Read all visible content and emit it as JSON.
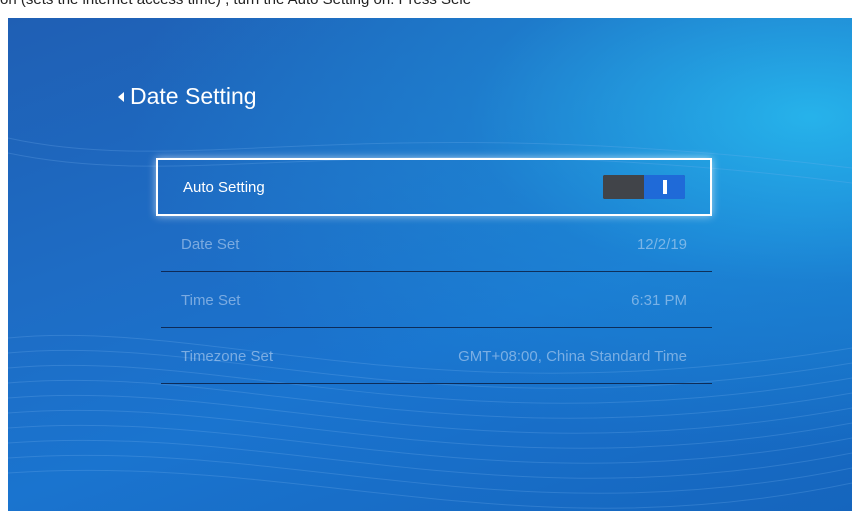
{
  "caption": "on (sets the internet access time) , turn the Auto Setting on. Press Sele",
  "header": {
    "title": "Date Setting",
    "back_icon": "chevron-left-icon"
  },
  "settings": {
    "auto_setting": {
      "label": "Auto Setting",
      "toggle_on": true
    },
    "date_set": {
      "label": "Date Set",
      "value": "12/2/19"
    },
    "time_set": {
      "label": "Time Set",
      "value": "6:31 PM"
    },
    "timezone_set": {
      "label": "Timezone Set",
      "value": "GMT+08:00, China Standard Time"
    }
  },
  "colors": {
    "background": "#1e6cc4",
    "toggle_knob": "#1f6ad8",
    "focus_border": "#ffffff"
  }
}
